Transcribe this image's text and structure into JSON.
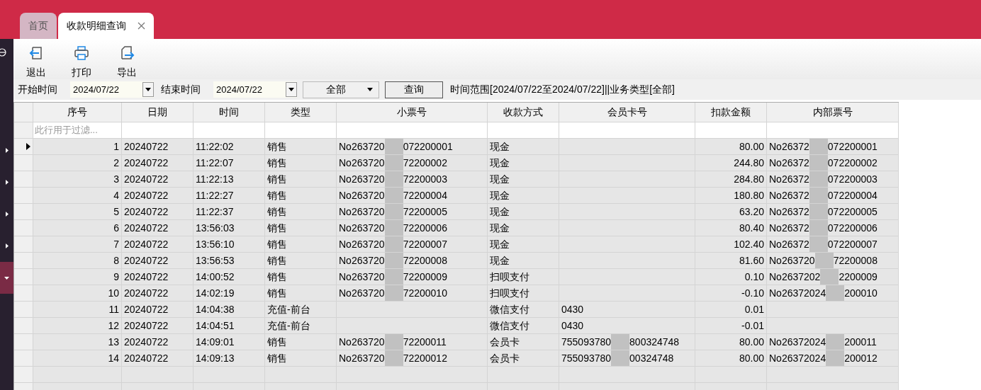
{
  "tabs": [
    {
      "label": "首页",
      "selected": false
    },
    {
      "label": "收款明细查询",
      "selected": true
    }
  ],
  "sidebar": {
    "items": [
      {
        "expanded": false,
        "selected": false
      },
      {
        "expanded": false,
        "selected": false
      },
      {
        "expanded": false,
        "selected": false
      },
      {
        "expanded": false,
        "selected": false
      },
      {
        "expanded": true,
        "selected": true
      }
    ]
  },
  "toolbar": [
    {
      "label": "退出",
      "kind": "exit"
    },
    {
      "label": "打印",
      "kind": "print"
    },
    {
      "label": "导出",
      "kind": "export"
    }
  ],
  "filters": {
    "start_label": "开始时间",
    "start_value": "2024/07/22",
    "end_label": "结束时间",
    "end_value": "2024/07/22",
    "type_value": "全部",
    "query_button": "查询",
    "summary": "时间范围[2024/07/22至2024/07/22]||业务类型[全部]"
  },
  "table": {
    "columns": [
      {
        "label": "序号"
      },
      {
        "label": "日期"
      },
      {
        "label": "时间"
      },
      {
        "label": "类型"
      },
      {
        "label": "小票号"
      },
      {
        "label": "收款方式"
      },
      {
        "label": "会员卡号"
      },
      {
        "label": "扣款金额"
      },
      {
        "label": "内部票号"
      }
    ],
    "filter_placeholder": "此行用于过滤...",
    "rows": [
      {
        "selected": true,
        "cells": [
          "1",
          "20240722",
          "11:22:02",
          "销售",
          [
            "No263720",
            "072200001"
          ],
          "现金",
          "",
          "80.00",
          [
            "No26372",
            "072200001"
          ]
        ]
      },
      {
        "selected": false,
        "cells": [
          "2",
          "20240722",
          "11:22:07",
          "销售",
          [
            "No263720",
            "72200002"
          ],
          "现金",
          "",
          "244.80",
          [
            "No26372",
            "072200002"
          ]
        ]
      },
      {
        "selected": false,
        "cells": [
          "3",
          "20240722",
          "11:22:13",
          "销售",
          [
            "No263720",
            "72200003"
          ],
          "现金",
          "",
          "284.80",
          [
            "No26372",
            "072200003"
          ]
        ]
      },
      {
        "selected": false,
        "cells": [
          "4",
          "20240722",
          "11:22:27",
          "销售",
          [
            "No263720",
            "72200004"
          ],
          "现金",
          "",
          "180.80",
          [
            "No26372",
            "072200004"
          ]
        ]
      },
      {
        "selected": false,
        "cells": [
          "5",
          "20240722",
          "11:22:37",
          "销售",
          [
            "No263720",
            "72200005"
          ],
          "现金",
          "",
          "63.20",
          [
            "No26372",
            "072200005"
          ]
        ]
      },
      {
        "selected": false,
        "cells": [
          "6",
          "20240722",
          "13:56:03",
          "销售",
          [
            "No263720",
            "72200006"
          ],
          "现金",
          "",
          "80.40",
          [
            "No26372",
            "072200006"
          ]
        ]
      },
      {
        "selected": false,
        "cells": [
          "7",
          "20240722",
          "13:56:10",
          "销售",
          [
            "No263720",
            "72200007"
          ],
          "现金",
          "",
          "102.40",
          [
            "No26372",
            "072200007"
          ]
        ]
      },
      {
        "selected": false,
        "cells": [
          "8",
          "20240722",
          "13:56:53",
          "销售",
          [
            "No263720",
            "72200008"
          ],
          "现金",
          "",
          "81.60",
          [
            "No263720",
            "72200008"
          ]
        ]
      },
      {
        "selected": false,
        "cells": [
          "9",
          "20240722",
          "14:00:52",
          "销售",
          [
            "No263720",
            "72200009"
          ],
          "扫呗支付",
          "",
          "0.10",
          [
            "No2637202",
            "2200009"
          ]
        ]
      },
      {
        "selected": false,
        "cells": [
          "10",
          "20240722",
          "14:02:19",
          "销售",
          [
            "No263720",
            "72200010"
          ],
          "扫呗支付",
          "",
          "-0.10",
          [
            "No26372024",
            "200010"
          ]
        ]
      },
      {
        "selected": false,
        "cells": [
          "11",
          "20240722",
          "14:04:38",
          "充值-前台",
          "",
          "微信支付",
          "0430",
          "0.01",
          ""
        ]
      },
      {
        "selected": false,
        "cells": [
          "12",
          "20240722",
          "14:04:51",
          "充值-前台",
          "",
          "微信支付",
          "0430",
          "-0.01",
          ""
        ]
      },
      {
        "selected": false,
        "cells": [
          "13",
          "20240722",
          "14:09:01",
          "销售",
          [
            "No263720",
            "72200011"
          ],
          "会员卡",
          [
            "755093780",
            "800324748"
          ],
          "80.00",
          [
            "No26372024",
            "200011"
          ]
        ]
      },
      {
        "selected": false,
        "cells": [
          "14",
          "20240722",
          "14:09:13",
          "销售",
          [
            "No263720",
            "72200012"
          ],
          "会员卡",
          [
            "755093780",
            "00324748"
          ],
          "80.00",
          [
            "No26372024",
            "200012"
          ]
        ]
      }
    ]
  }
}
